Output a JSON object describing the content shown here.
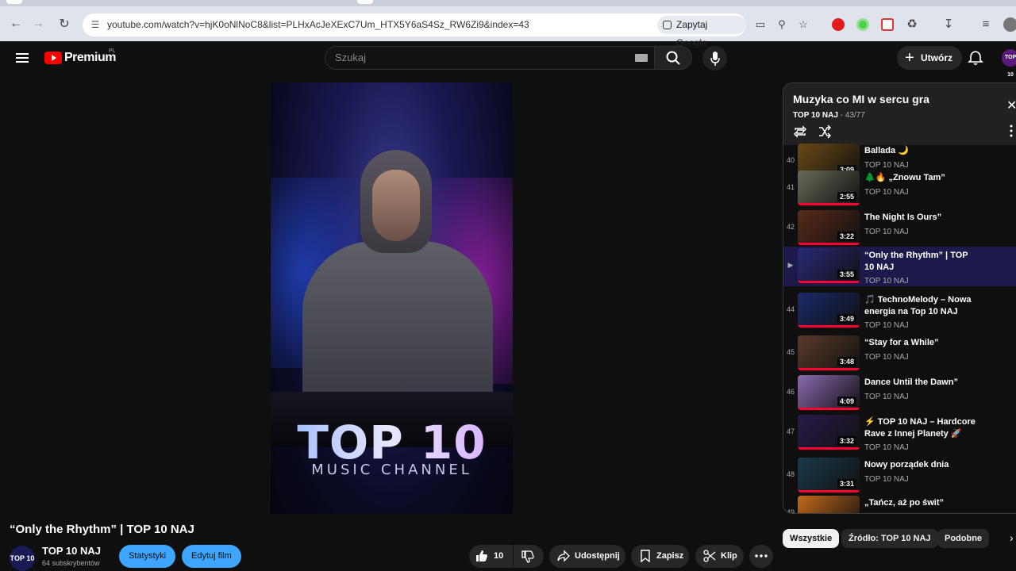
{
  "browser": {
    "url": "youtube.com/watch?v=hjK0oNlNoC8&list=PLHxAcJeXExC7Um_HTX5Y6aS4Sz_RW6Zi9&index=43",
    "google_button": "Zapytaj Google"
  },
  "header": {
    "brand": "Premium",
    "region": "PL",
    "search_placeholder": "Szukaj",
    "create_label": "Utwórz",
    "avatar_text": "TOP 10"
  },
  "player": {
    "overlay_title": "TOP 10",
    "overlay_subtitle": "MUSIC CHANNEL"
  },
  "playlist": {
    "title": "Muzyka co MI w sercu gra",
    "owner": "TOP 10  NAJ",
    "position": "- 43/77",
    "items": [
      {
        "num": "40",
        "title": "Ballada 🌙",
        "channel": "TOP 10 NAJ",
        "duration": "3:09",
        "thumb": "#6b4a14",
        "active": false,
        "playing": false
      },
      {
        "num": "41",
        "title": "🌲🔥 „Znowu Tam”",
        "channel": "TOP 10 NAJ",
        "duration": "2:55",
        "thumb": "#6a6a5a",
        "active": false,
        "playing": false
      },
      {
        "num": "42",
        "title": "The Night Is Ours”",
        "channel": "TOP 10 NAJ",
        "duration": "3:22",
        "thumb": "#5a2a1a",
        "active": false,
        "playing": false
      },
      {
        "num": "▶",
        "title": "“Only the Rhythm” | TOP 10 NAJ",
        "channel": "TOP 10 NAJ",
        "duration": "3:55",
        "thumb": "#2a2a7a",
        "active": true,
        "playing": true
      },
      {
        "num": "44",
        "title": "🎵 TechnoMelody – Nowa energia na Top 10 NAJ",
        "channel": "TOP 10 NAJ",
        "duration": "3:49",
        "thumb": "#1a2a6a",
        "active": false,
        "playing": false
      },
      {
        "num": "45",
        "title": "“Stay for a While”",
        "channel": "TOP 10 NAJ",
        "duration": "3:48",
        "thumb": "#5a3a2a",
        "active": false,
        "playing": false
      },
      {
        "num": "46",
        "title": "Dance Until the Dawn”",
        "channel": "TOP 10 NAJ",
        "duration": "4:09",
        "thumb": "#8a6ab0",
        "active": false,
        "playing": false
      },
      {
        "num": "47",
        "title": "⚡ TOP 10 NAJ – Hardcore Rave z Innej Planety 🚀",
        "channel": "TOP 10 NAJ",
        "duration": "3:32",
        "thumb": "#2a1a4a",
        "active": false,
        "playing": false
      },
      {
        "num": "48",
        "title": "Nowy porządek dnia",
        "channel": "TOP 10 NAJ",
        "duration": "3:31",
        "thumb": "#1a3a4a",
        "active": false,
        "playing": false
      },
      {
        "num": "49",
        "title": "„Tańcz, aż po świt”",
        "channel": "TOP 10 NAJ",
        "duration": "",
        "thumb": "#c46a1a",
        "active": false,
        "playing": false
      }
    ]
  },
  "video": {
    "title": "“Only the Rhythm” | TOP 10 NAJ",
    "channel_name": "TOP 10  NAJ",
    "subscribers": "64 subskrybentów",
    "channel_avatar": "TOP 10",
    "stats_label": "Statystyki",
    "edit_label": "Edytuj film",
    "likes": "10",
    "share_label": "Udostępnij",
    "save_label": "Zapisz",
    "clip_label": "Klip"
  },
  "chips": {
    "all": "Wszystkie",
    "source": "Źródło: TOP 10 NAJ",
    "related": "Podobne"
  },
  "colors": {
    "background": "#0f0f0f",
    "accent_red": "#ff0000",
    "button_blue": "#3ea6ff",
    "active_row": "#1c1a4a"
  }
}
